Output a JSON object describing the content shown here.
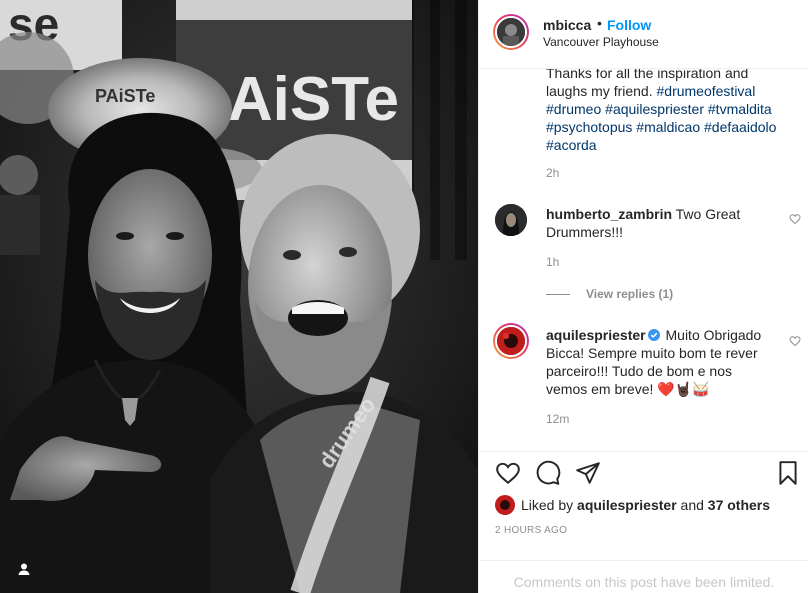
{
  "post": {
    "photo_brand_text": "pAiSTe",
    "photo_cymbal_text": "PAiSTe",
    "photo_shirt_text": "drumeo"
  },
  "header": {
    "username": "mbicca",
    "dot": "•",
    "follow_label": "Follow",
    "location": "Vancouver Playhouse"
  },
  "caption": {
    "lead": "Thanks for all the inspiration and laughs my friend.",
    "tags": [
      "#drumeofestival",
      "#drumeo",
      "#aquilespriester",
      "#tvmaldita",
      "#psychotopus",
      "#maldicao",
      "#defaaidolo",
      "#acorda"
    ],
    "time": "2h"
  },
  "comments": [
    {
      "username": "humberto_zambrin",
      "text": "Two Great Drummers!!!",
      "time": "1h",
      "view_replies": "View replies (1)"
    },
    {
      "username": "aquilespriester",
      "text": "Muito Obrigado Bicca! Sempre muito bom te rever parceiro!!! Tudo de bom e nos vemos em breve!",
      "emoji": "❤️🤘🏿🥁",
      "time": "12m"
    }
  ],
  "actions": {
    "liked_by_prefix": "Liked by",
    "liked_by_user": "aquilespriester",
    "and": "and",
    "others": "37 others",
    "post_age": "2 HOURS AGO",
    "comments_limited": "Comments on this post have been limited."
  },
  "icons": {
    "like": "heart-icon",
    "comment": "comment-icon",
    "share": "share-icon",
    "save": "bookmark-icon",
    "user_tag": "user-icon"
  },
  "colors": {
    "link_blue": "#0095f6",
    "hashtag": "#00376b",
    "secondary": "#8e8e8e",
    "verified": "#3897f0"
  }
}
